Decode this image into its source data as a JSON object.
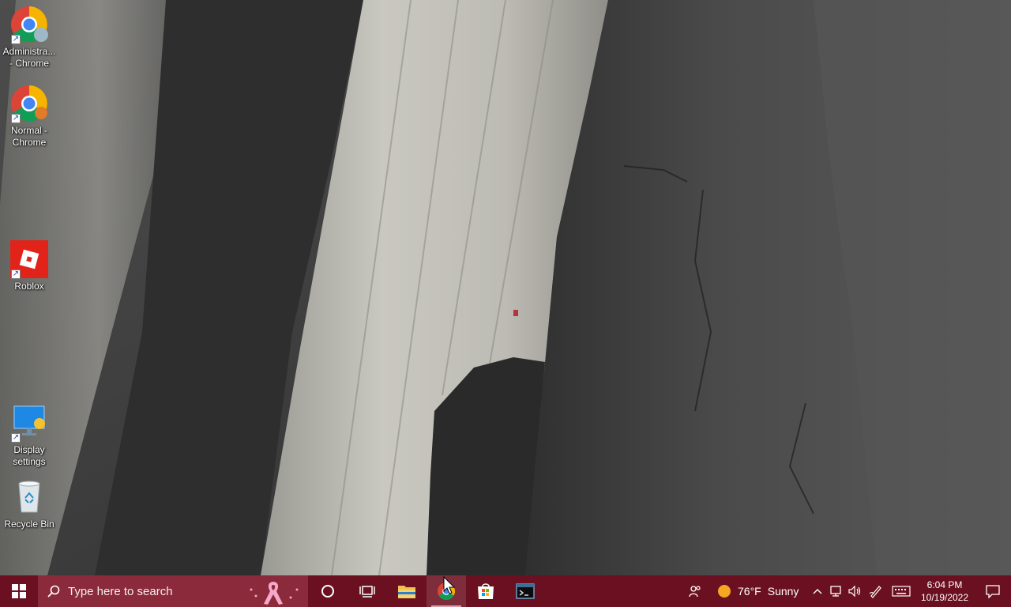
{
  "desktop": {
    "icons": [
      {
        "label": "Administra... - Chrome",
        "icon": "chrome-icon"
      },
      {
        "label": "Normal - Chrome",
        "icon": "chrome-icon"
      },
      {
        "label": "Roblox",
        "icon": "roblox-icon"
      },
      {
        "label": "Display settings",
        "icon": "display-settings-icon"
      },
      {
        "label": "Recycle Bin",
        "icon": "recycle-bin-icon"
      }
    ]
  },
  "taskbar": {
    "search_placeholder": "Type here to search",
    "pinned": [
      "cortana-icon",
      "task-view-icon",
      "file-explorer-icon",
      "chrome-icon",
      "microsoft-store-icon",
      "terminal-icon"
    ],
    "weather": {
      "temp": "76°F",
      "condition": "Sunny"
    },
    "clock": {
      "time": "6:04 PM",
      "date": "10/19/2022"
    }
  },
  "colors": {
    "taskbar": "#6b1020",
    "search": "#8a2a3a"
  }
}
